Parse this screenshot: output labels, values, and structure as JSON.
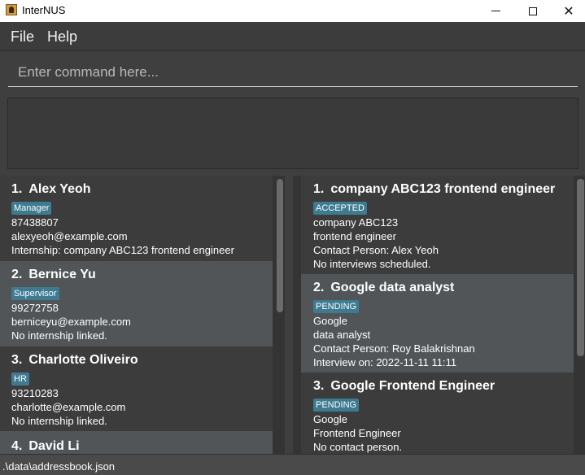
{
  "window": {
    "title": "InterNUS",
    "min_glyph": "",
    "close_glyph": "✕"
  },
  "menu": {
    "file": "File",
    "help": "Help"
  },
  "command": {
    "placeholder": "Enter command here...",
    "value": ""
  },
  "result_display": {
    "text": ""
  },
  "persons": [
    {
      "index": "1.",
      "name": "Alex Yeoh",
      "tag": "Manager",
      "phone": "87438807",
      "email": "alexyeoh@example.com",
      "internship": "Internship: company ABC123 frontend engineer"
    },
    {
      "index": "2.",
      "name": "Bernice Yu",
      "tag": "Supervisor",
      "phone": "99272758",
      "email": "berniceyu@example.com",
      "internship": "No internship linked."
    },
    {
      "index": "3.",
      "name": "Charlotte Oliveiro",
      "tag": "HR",
      "phone": "93210283",
      "email": "charlotte@example.com",
      "internship": "No internship linked."
    },
    {
      "index": "4.",
      "name": "David Li"
    }
  ],
  "internships": [
    {
      "index": "1.",
      "title": "company ABC123 frontend engineer",
      "status": "ACCEPTED",
      "company": "company ABC123",
      "role": "frontend engineer",
      "contact": "Contact Person: Alex Yeoh",
      "interview": "No interviews scheduled."
    },
    {
      "index": "2.",
      "title": "Google data analyst",
      "status": "PENDING",
      "company": "Google",
      "role": "data analyst",
      "contact": "Contact Person: Roy Balakrishnan",
      "interview": "Interview on: 2022-11-11 11:11"
    },
    {
      "index": "3.",
      "title": "Google Frontend Engineer",
      "status": "PENDING",
      "company": "Google",
      "role": "Frontend Engineer",
      "contact": "No contact person."
    }
  ],
  "status_bar": {
    "path": ".\\data\\addressbook.json"
  },
  "colors": {
    "background": "#3f3f3f",
    "card_dark": "#3c3c3c",
    "card_selected": "#515558",
    "tag": "#3e7b91"
  }
}
